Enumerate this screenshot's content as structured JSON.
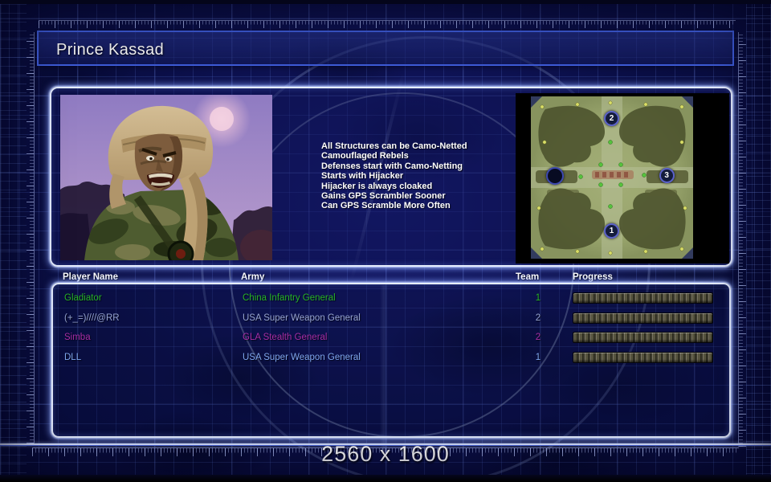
{
  "window": {
    "title": "Prince Kassad",
    "resolution_label": "2560 x 1600"
  },
  "general_panel": {
    "abilities": [
      "All Structures can be Camo-Netted",
      "Camouflaged Rebels",
      "Defenses start with Camo-Netting",
      "Starts with Hijacker",
      "Hijacker is always cloaked",
      "Gains GPS Scrambler Sooner",
      "Can GPS Scramble More Often"
    ]
  },
  "minimap": {
    "markers": [
      {
        "label": "2",
        "type": "start",
        "x": 50,
        "y": 14
      },
      {
        "label": "3",
        "type": "start",
        "x": 84,
        "y": 49
      },
      {
        "label": "1",
        "type": "start",
        "x": 50,
        "y": 83
      },
      {
        "label": "",
        "type": "player",
        "x": 15,
        "y": 49
      }
    ]
  },
  "player_table": {
    "columns": [
      "Player Name",
      "Army",
      "Team",
      "Progress"
    ],
    "rows": [
      {
        "name": "Gladiator",
        "army": "China Infantry General",
        "team": "1",
        "color": "#27b327",
        "progress": 100
      },
      {
        "name": "(+_=)////@RR",
        "army": "USA Super Weapon General",
        "team": "2",
        "color": "#96a4d2",
        "progress": 100
      },
      {
        "name": "Simba",
        "army": "GLA Stealth General",
        "team": "2",
        "color": "#a62ea6",
        "progress": 100
      },
      {
        "name": "DLL",
        "army": "USA Super Weapon General",
        "team": "1",
        "color": "#7fa6ee",
        "progress": 100
      }
    ]
  },
  "colors": {
    "background": "#0b0f45",
    "panel_glow": "#e6eeff",
    "title_bar_border": "#3e5cd8",
    "grid_line": "#5f7de1",
    "header_text": "#ffffff",
    "ability_text": "#ffffff",
    "progress_segment": "#57543f"
  }
}
